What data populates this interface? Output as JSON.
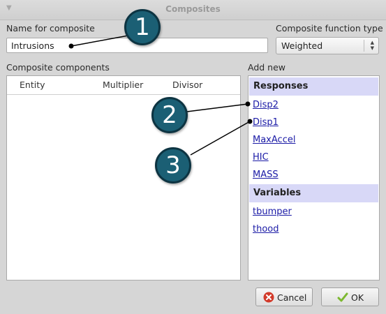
{
  "window": {
    "title": "Composites"
  },
  "name_field": {
    "label": "Name for composite",
    "value": "Intrusions"
  },
  "function_type": {
    "label": "Composite function type",
    "selected": "Weighted"
  },
  "components": {
    "label": "Composite components",
    "columns": [
      "Entity",
      "Multiplier",
      "Divisor"
    ]
  },
  "add_new": {
    "label": "Add new",
    "responses_header": "Responses",
    "responses": [
      "Disp2",
      "Disp1",
      "MaxAccel",
      "HIC",
      "MASS"
    ],
    "variables_header": "Variables",
    "variables": [
      "tbumper",
      "thood"
    ]
  },
  "buttons": {
    "cancel": "Cancel",
    "ok": "OK"
  },
  "callouts": [
    "1",
    "2",
    "3"
  ]
}
